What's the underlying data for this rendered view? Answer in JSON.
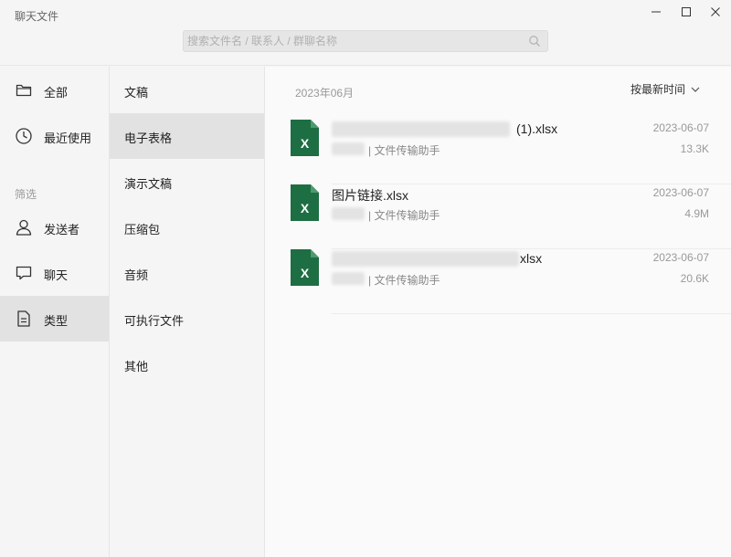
{
  "app": {
    "title": "聊天文件"
  },
  "search": {
    "placeholder": "搜索文件名 / 联系人 / 群聊名称"
  },
  "window_controls": [
    "minimize-icon",
    "maximize-icon",
    "close-icon"
  ],
  "sidebar": {
    "filter_label": "筛选",
    "items": [
      {
        "label": "全部",
        "icon": "folder-icon"
      },
      {
        "label": "最近使用",
        "icon": "clock-icon"
      },
      {
        "label": "发送者",
        "icon": "person-icon"
      },
      {
        "label": "聊天",
        "icon": "chat-icon"
      },
      {
        "label": "类型",
        "icon": "document-icon",
        "active": true
      }
    ]
  },
  "types": {
    "items": [
      {
        "label": "文稿"
      },
      {
        "label": "电子表格",
        "active": true
      },
      {
        "label": "演示文稿"
      },
      {
        "label": "压缩包"
      },
      {
        "label": "音频"
      },
      {
        "label": "可执行文件"
      },
      {
        "label": "其他"
      }
    ]
  },
  "main": {
    "month": "2023年06月",
    "sort_label": "按最新时间",
    "files": [
      {
        "name": "(1).xlsx",
        "source": "| 文件传输助手",
        "date": "2023-06-07",
        "size": "13.3K",
        "icon": "excel-icon"
      },
      {
        "name": "图片链接.xlsx",
        "source": "| 文件传输助手",
        "date": "2023-06-07",
        "size": "4.9M",
        "icon": "excel-icon"
      },
      {
        "name": "xlsx",
        "source": "| 文件传输助手",
        "date": "2023-06-07",
        "size": "20.6K",
        "icon": "excel-icon"
      }
    ]
  },
  "colors": {
    "excel_green": "#1e6e43",
    "active_bg": "#e2e2e2"
  }
}
